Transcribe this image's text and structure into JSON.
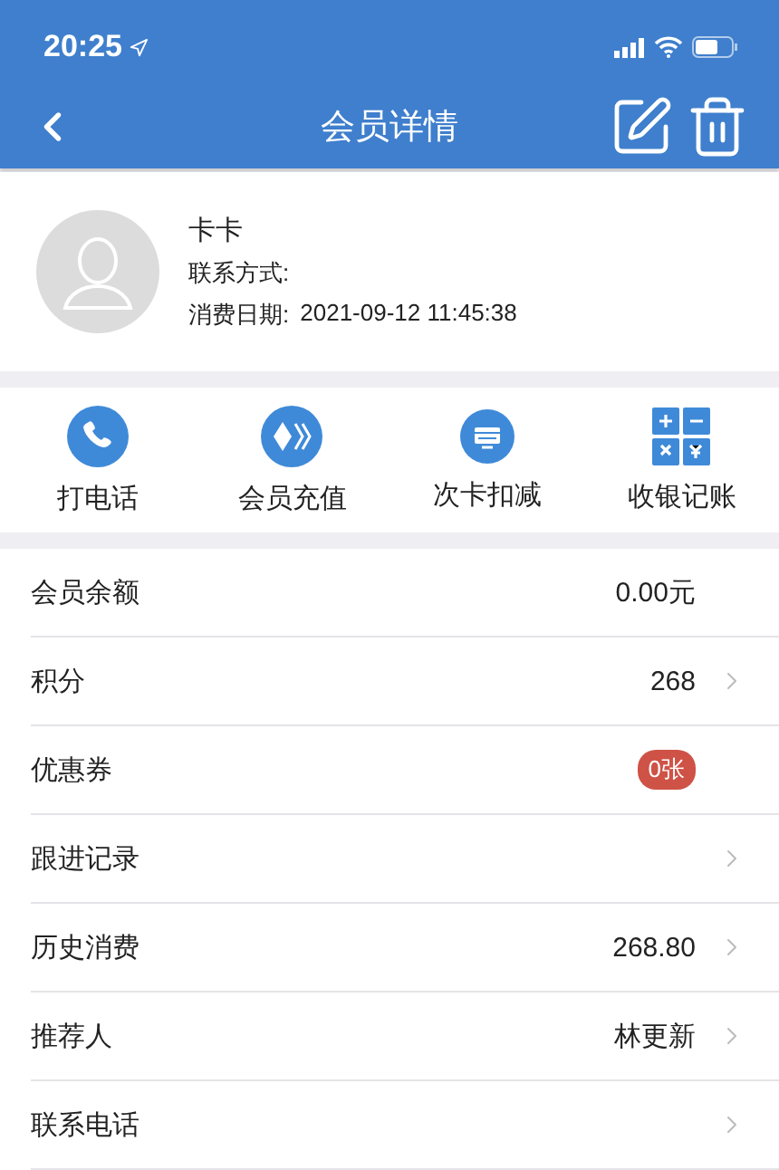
{
  "status_bar": {
    "time": "20:25"
  },
  "nav": {
    "title": "会员详情"
  },
  "member": {
    "name": "卡卡",
    "contact_label": "联系方式:",
    "date_label": "消费日期:",
    "date": "2021-09-12 11:45:38"
  },
  "actions": [
    {
      "kind": "phone",
      "label": "打电话"
    },
    {
      "kind": "recharge",
      "label": "会员充值"
    },
    {
      "kind": "card",
      "label": "次卡扣减"
    },
    {
      "kind": "calculator",
      "label": "收银记账"
    }
  ],
  "rows": [
    {
      "label": "会员余额",
      "value": "0.00元",
      "arrow": false
    },
    {
      "label": "积分",
      "value": "268",
      "arrow": true
    },
    {
      "label": "优惠券",
      "badge": "0张",
      "arrow": false
    },
    {
      "label": "跟进记录",
      "arrow": true
    },
    {
      "label": "历史消费",
      "value": "268.80",
      "arrow": true
    },
    {
      "label": "推荐人",
      "value": "林更新",
      "arrow": true
    },
    {
      "label": "联系电话",
      "arrow": true
    }
  ]
}
